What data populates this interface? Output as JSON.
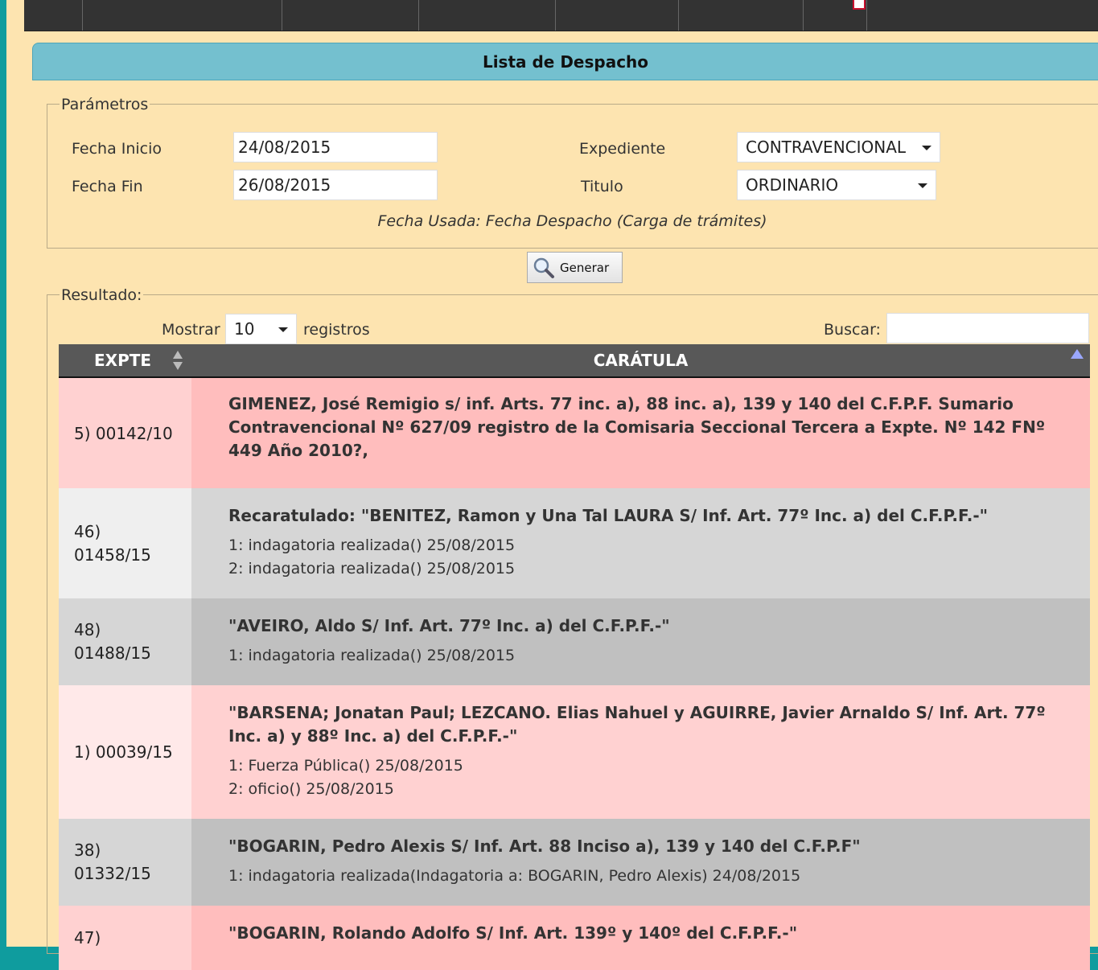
{
  "panel": {
    "title": "Lista de Despacho"
  },
  "parametros": {
    "legend": "Parámetros",
    "fecha_inicio_label": "Fecha Inicio",
    "fecha_inicio_value": "24/08/2015",
    "fecha_fin_label": "Fecha Fin",
    "fecha_fin_value": "26/08/2015",
    "expediente_label": "Expediente",
    "expediente_value": "CONTRAVENCIONAL",
    "titulo_label": "Titulo",
    "titulo_value": "ORDINARIO",
    "note": "Fecha Usada: Fecha Despacho (Carga de trámites)"
  },
  "generar_label": "Generar",
  "resultado": {
    "legend": "Resultado:",
    "mostrar_label": "Mostrar",
    "mostrar_value": "10",
    "registros_label": "registros",
    "buscar_label": "Buscar:",
    "buscar_value": ""
  },
  "table": {
    "headers": [
      "EXPTE",
      "CARÁTULA"
    ],
    "rows": [
      {
        "expte": "5) 00142/10",
        "caratula": "GIMENEZ, José Remigio s/ inf. Arts. 77 inc. a), 88 inc. a), 139 y 140 del C.F.P.F. Sumario Contravencional Nº 627/09 registro de la Comisaria Seccional Tercera a Expte. Nº 142 FNº 449 Año 2010?,",
        "tramites": []
      },
      {
        "expte": "46) 01458/15",
        "caratula": "Recaratulado: \"BENITEZ, Ramon y Una Tal LAURA S/ Inf. Art. 77º Inc. a) del C.F.P.F.-\"",
        "tramites": [
          "1: indagatoria realizada() 25/08/2015",
          "2: indagatoria realizada() 25/08/2015"
        ]
      },
      {
        "expte": "48) 01488/15",
        "caratula": "\"AVEIRO, Aldo S/ Inf. Art. 77º Inc. a) del C.F.P.F.-\"",
        "tramites": [
          "1: indagatoria realizada() 25/08/2015"
        ]
      },
      {
        "expte": "1) 00039/15",
        "caratula": "\"BARSENA; Jonatan Paul; LEZCANO. Elias Nahuel y AGUIRRE, Javier Arnaldo S/ Inf. Art. 77º Inc. a) y 88º Inc. a) del C.F.P.F.-\"",
        "tramites": [
          "1: Fuerza Pública() 25/08/2015",
          "2: oficio() 25/08/2015"
        ]
      },
      {
        "expte": "38) 01332/15",
        "caratula": "\"BOGARIN, Pedro Alexis S/ Inf. Art. 88 Inciso a), 139 y 140 del C.F.P.F\"",
        "tramites": [
          "1: indagatoria realizada(Indagatoria a: BOGARIN, Pedro Alexis) 24/08/2015"
        ]
      },
      {
        "expte": "47)",
        "caratula": "\"BOGARIN, Rolando Adolfo S/ Inf. Art. 139º y 140º del C.F.P.F.-\"",
        "tramites": []
      }
    ]
  }
}
